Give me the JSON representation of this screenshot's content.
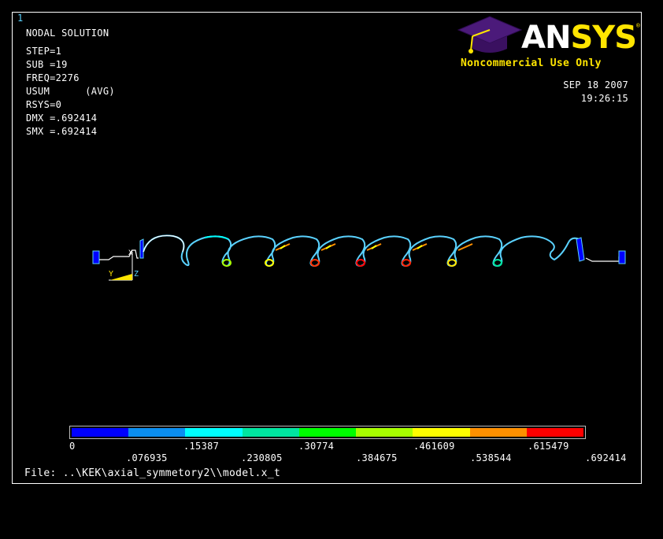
{
  "window_number": "1",
  "info": {
    "title": "NODAL SOLUTION",
    "lines": [
      "STEP=1",
      "SUB =19",
      "FREQ=2276",
      "USUM      (AVG)",
      "RSYS=0",
      "DMX =.692414",
      "SMX =.692414"
    ]
  },
  "logo": {
    "text_an": "AN",
    "text_sys": "SYS",
    "reg": "®",
    "noncommercial": "Noncommercial Use Only"
  },
  "date": {
    "date": "SEP 18 2007",
    "time": "19:26:15"
  },
  "triad": {
    "x": "X",
    "y": "Y",
    "z": "Z"
  },
  "legend": {
    "colors": [
      "#0000ff",
      "#0b8ef0",
      "#00ffff",
      "#00e5a0",
      "#00ff00",
      "#a8ff00",
      "#ffff00",
      "#ff9000",
      "#ff0000"
    ],
    "top_labels": [
      "0",
      ".15387",
      ".30774",
      ".461609",
      ".615479"
    ],
    "bottom_labels": [
      ".076935",
      ".230805",
      ".384675",
      ".538544",
      ".692414"
    ]
  },
  "file": "File: ..\\KEK\\axial_symmetory2\\\\model.x_t"
}
